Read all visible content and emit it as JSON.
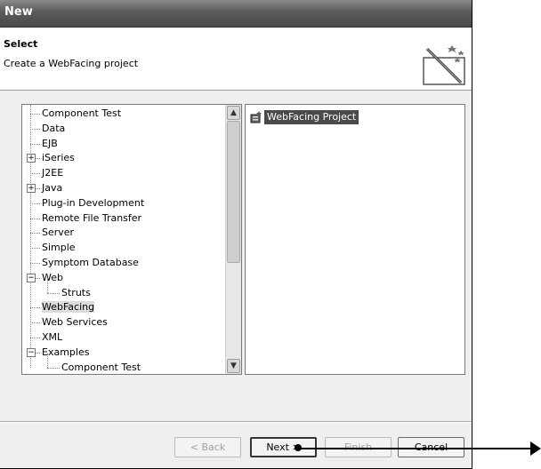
{
  "window": {
    "title": "New"
  },
  "header": {
    "title": "Select",
    "description": "Create a WebFacing project",
    "icon": "wizard-wand-icon"
  },
  "tree": {
    "items": [
      {
        "label": "Component Test",
        "level": 0,
        "expander": ""
      },
      {
        "label": "Data",
        "level": 0,
        "expander": ""
      },
      {
        "label": "EJB",
        "level": 0,
        "expander": ""
      },
      {
        "label": "iSeries",
        "level": 0,
        "expander": "+"
      },
      {
        "label": "J2EE",
        "level": 0,
        "expander": ""
      },
      {
        "label": "Java",
        "level": 0,
        "expander": "+"
      },
      {
        "label": "Plug-in Development",
        "level": 0,
        "expander": ""
      },
      {
        "label": "Remote File Transfer",
        "level": 0,
        "expander": ""
      },
      {
        "label": "Server",
        "level": 0,
        "expander": ""
      },
      {
        "label": "Simple",
        "level": 0,
        "expander": ""
      },
      {
        "label": "Symptom Database",
        "level": 0,
        "expander": ""
      },
      {
        "label": "Web",
        "level": 0,
        "expander": "-"
      },
      {
        "label": "Struts",
        "level": 1,
        "expander": ""
      },
      {
        "label": "WebFacing",
        "level": 0,
        "expander": "",
        "selected": true
      },
      {
        "label": "Web Services",
        "level": 0,
        "expander": ""
      },
      {
        "label": "XML",
        "level": 0,
        "expander": ""
      },
      {
        "label": "Examples",
        "level": 0,
        "expander": "-"
      },
      {
        "label": "Component Test",
        "level": 1,
        "expander": ""
      }
    ]
  },
  "wizards": {
    "items": [
      {
        "label": "WebFacing Project",
        "icon": "webfacing-project-icon"
      }
    ]
  },
  "buttons": {
    "back": "< Back",
    "next": "Next >",
    "finish": "Finish",
    "cancel": "Cancel"
  },
  "annotation": {
    "color": "#000000"
  }
}
